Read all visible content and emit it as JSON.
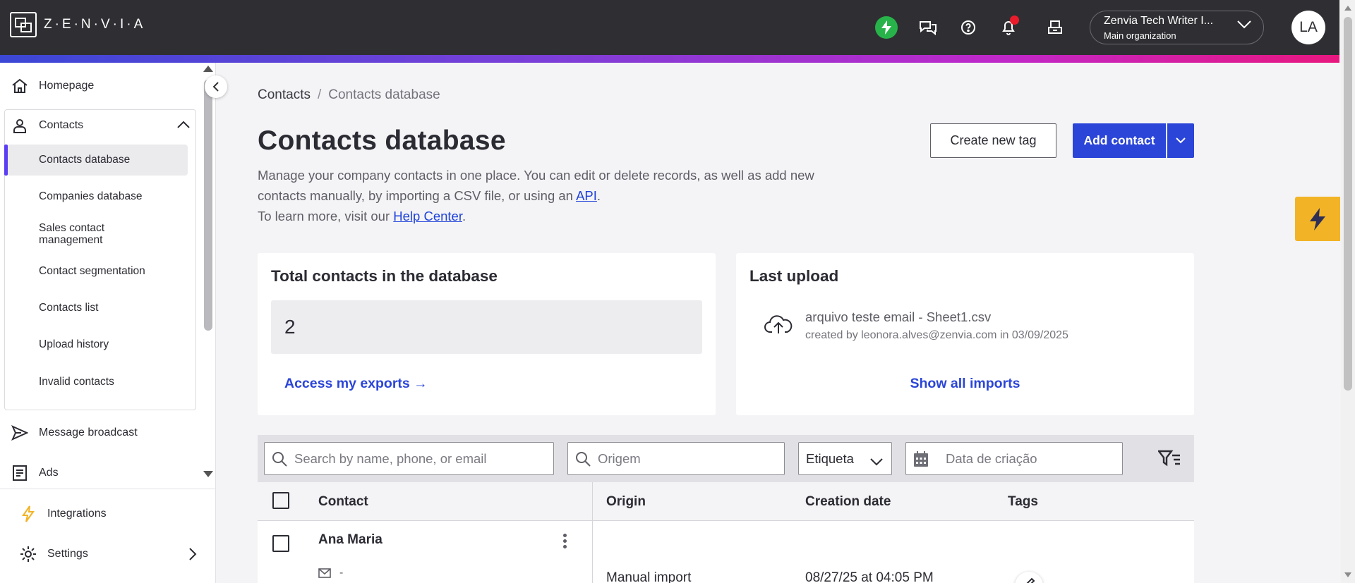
{
  "app": {
    "logo_text": "Z·E·N·V·I·A"
  },
  "topbar": {
    "org_name": "Zenvia Tech Writer I...",
    "org_sub": "Main organization",
    "avatar": "LA",
    "icons": [
      "bolt-icon",
      "chat-icon",
      "help-icon",
      "bell-icon",
      "inbox-icon"
    ],
    "notification_color": "#ea1c2c"
  },
  "sidebar": {
    "items": [
      {
        "label": "Homepage",
        "icon": "home-icon"
      },
      {
        "label": "Contacts",
        "icon": "person-icon",
        "expanded": true
      }
    ],
    "contacts_sub": [
      "Contacts database",
      "Companies database",
      "Sales contact management",
      "Contact segmentation",
      "Contacts list",
      "Upload history",
      "Invalid contacts"
    ],
    "active_sub": "Contacts database",
    "lower_items": [
      {
        "label": "Message broadcast",
        "icon": "send-icon"
      },
      {
        "label": "Ads",
        "icon": "ads-icon"
      }
    ],
    "bottom_items": [
      {
        "label": "Integrations",
        "icon": "integrations-bolt-icon"
      },
      {
        "label": "Settings",
        "icon": "gear-icon"
      }
    ]
  },
  "breadcrumb": {
    "root": "Contacts",
    "sep": "/",
    "current": "Contacts database"
  },
  "page": {
    "title": "Contacts database",
    "desc_line1_a": "Manage your company contacts in one place. You can edit or delete records, as well as add new contacts manually, by importing a CSV file, or using an ",
    "desc_api": "API",
    "desc_line1_b": ".",
    "desc_line2_a": "To learn more, visit our ",
    "desc_help": "Help Center",
    "desc_line2_b": ".",
    "create_tag_label": "Create new tag",
    "add_contact_label": "Add contact"
  },
  "total_card": {
    "title": "Total contacts in the database",
    "count": "2",
    "link": "Access my exports →"
  },
  "upload_card": {
    "title": "Last upload",
    "file": "arquivo teste email - Sheet1.csv",
    "created_by": "created by leonora.alves@zenvia.com in 03/09/2025",
    "link": "Show all imports"
  },
  "filters": {
    "search_placeholder": "Search by name, phone, or email",
    "origin_placeholder": "Origem",
    "tag_select": "Etiqueta",
    "date_placeholder": "Data de criação"
  },
  "table": {
    "columns": [
      "Contact",
      "Origin",
      "Creation date",
      "Tags"
    ],
    "rows": [
      {
        "name": "Ana Maria",
        "email": "-",
        "origin": "Manual import",
        "created": "08/27/25 at 04:05 PM"
      }
    ]
  },
  "colors": {
    "primary": "#2b45d8",
    "active_bar": "#5b3df5",
    "ray_tab": "#f2b326"
  }
}
